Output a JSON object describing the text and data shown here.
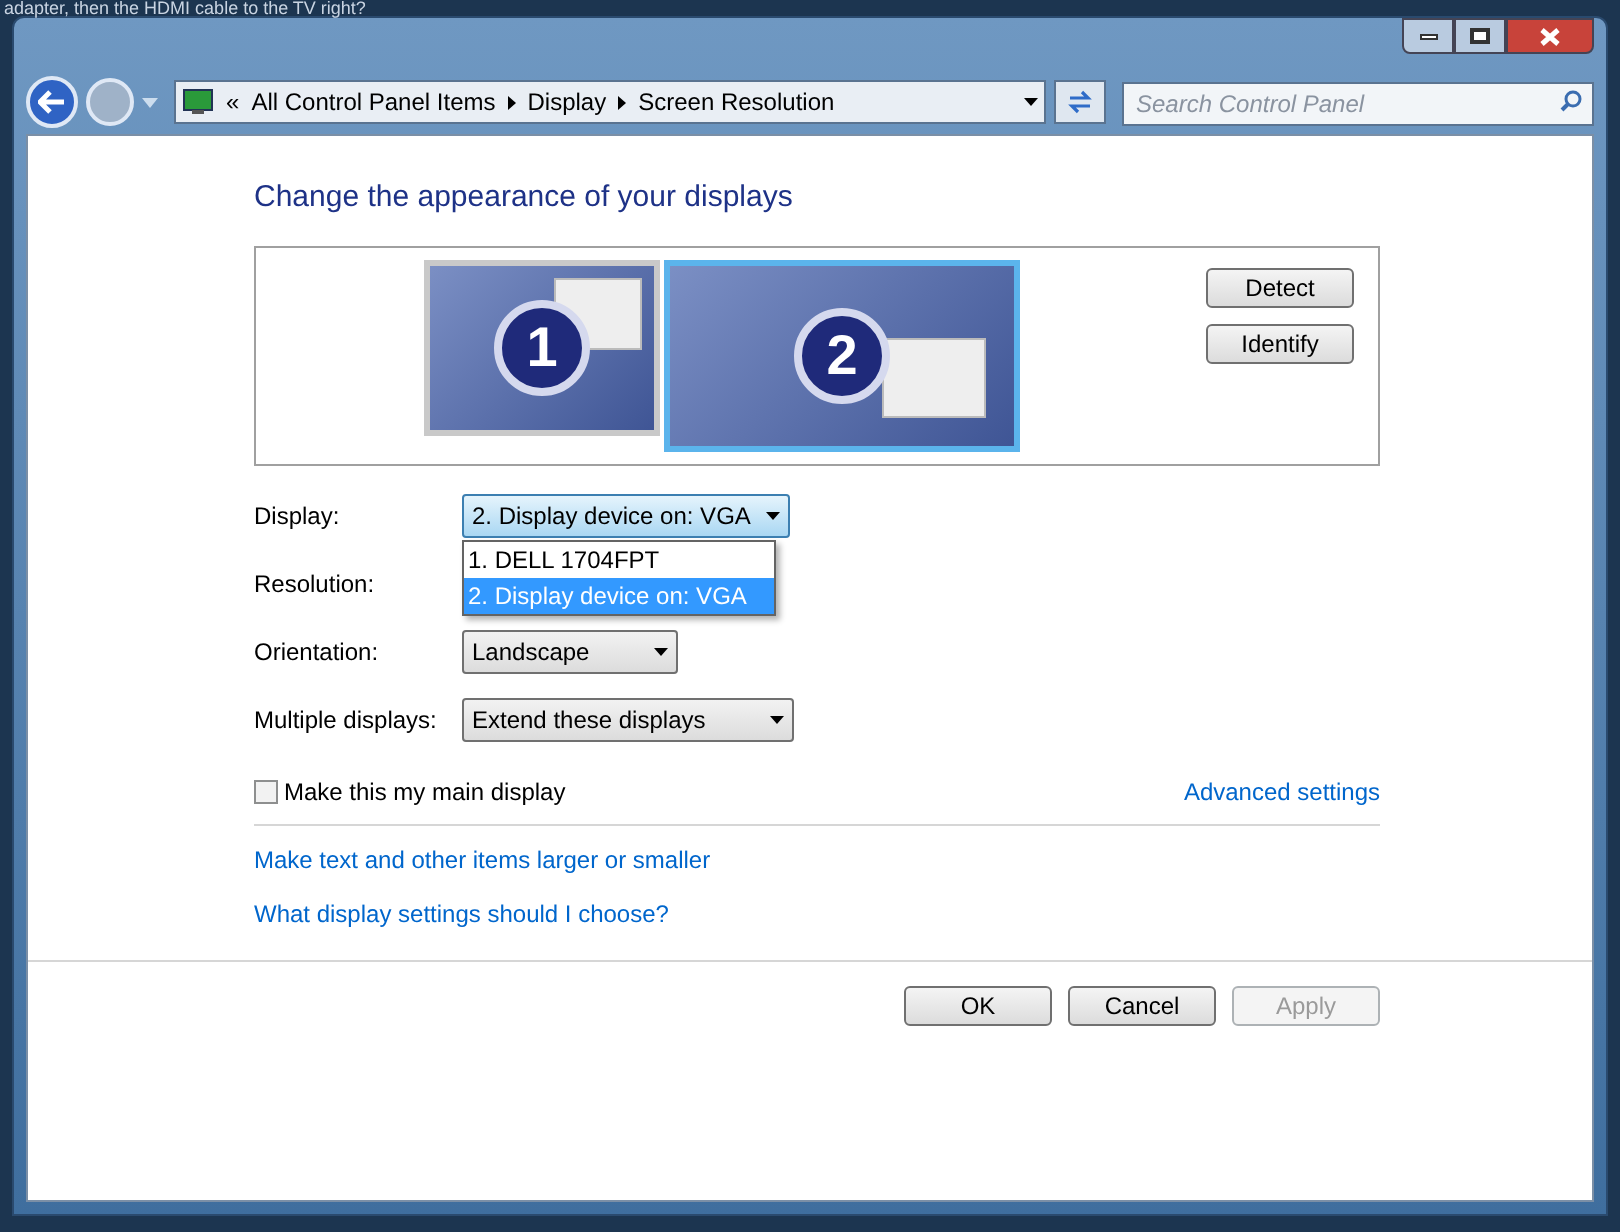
{
  "background_text": "adapter, then the HDMI cable to the TV right?",
  "address_bar": {
    "overflow": "«",
    "crumbs": [
      "All Control Panel Items",
      "Display",
      "Screen Resolution"
    ]
  },
  "search": {
    "placeholder": "Search Control Panel"
  },
  "heading": "Change the appearance of your displays",
  "monitors": [
    {
      "label": "1",
      "selected": false
    },
    {
      "label": "2",
      "selected": true
    }
  ],
  "monitor_buttons": [
    "Detect",
    "Identify"
  ],
  "settings": [
    {
      "label": "Display:",
      "kind": "open",
      "value": "2. Display device on: VGA",
      "options": [
        {
          "label": "1. DELL 1704FPT",
          "selected": false
        },
        {
          "label": "2. Display device on: VGA",
          "selected": true
        }
      ]
    },
    {
      "label": "Resolution:",
      "kind": "hidden"
    },
    {
      "label": "Orientation:",
      "kind": "combo",
      "value": "Landscape"
    },
    {
      "label": "Multiple displays:",
      "kind": "combo",
      "value": "Extend these displays"
    }
  ],
  "main_display": {
    "label": "Make this my main display",
    "checked": false
  },
  "advanced_link": "Advanced settings",
  "links": [
    "Make text and other items larger or smaller",
    "What display settings should I choose?"
  ],
  "buttons": [
    {
      "label": "OK",
      "disabled": false
    },
    {
      "label": "Cancel",
      "disabled": false
    },
    {
      "label": "Apply",
      "disabled": true
    }
  ]
}
